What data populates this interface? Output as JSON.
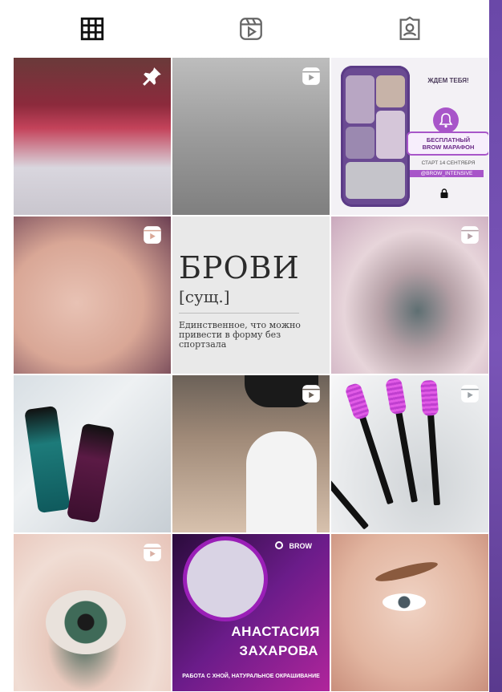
{
  "tabs": [
    {
      "name": "grid",
      "icon": "grid-icon",
      "active": true
    },
    {
      "name": "reels",
      "icon": "reels-icon",
      "active": false
    },
    {
      "name": "tagged",
      "icon": "tagged-icon",
      "active": false
    }
  ],
  "posts": {
    "p3": {
      "wait_text": "ЖДЕМ ТЕБЯ!",
      "marathon_line1": "БЕСПЛАТНЫЙ",
      "marathon_line2": "BROW МАРАФОН",
      "start_text": "СТАРТ 14 СЕНТЯБРЯ",
      "handle_text": "@BROW_INTENSIVE"
    },
    "p5": {
      "word": "БРОВИ",
      "part_of_speech": "[сущ.]",
      "definition": "Единственное, что можно привести в форму без спортзала"
    },
    "p11": {
      "brand": "BROW",
      "name_line1": "АНАСТАСИЯ",
      "name_line2": "ЗАХАРОВА",
      "subtitle": "РАБОТА С ХНОЙ, НАТУРАЛЬНОЕ ОКРАШИВАНИЕ"
    }
  },
  "badges": {
    "pinned": "pin-icon",
    "reel": "reel-icon"
  },
  "colors": {
    "accent_purple": "#a855c9",
    "frame_purple": "#5a3a8e"
  }
}
